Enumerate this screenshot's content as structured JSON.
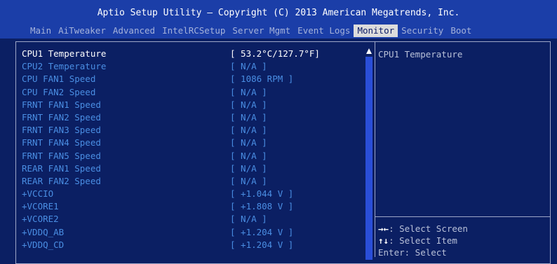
{
  "header": {
    "title": "Aptio Setup Utility – Copyright (C) 2013 American Megatrends, Inc.",
    "tabs": [
      {
        "label": "Main",
        "active": false
      },
      {
        "label": "AiTweaker",
        "active": false
      },
      {
        "label": "Advanced",
        "active": false
      },
      {
        "label": "IntelRCSetup",
        "active": false
      },
      {
        "label": "Server Mgmt",
        "active": false
      },
      {
        "label": "Event Logs",
        "active": false
      },
      {
        "label": "Monitor",
        "active": true
      },
      {
        "label": "Security",
        "active": false
      },
      {
        "label": "Boot",
        "active": false
      }
    ]
  },
  "monitor": {
    "items": [
      {
        "label": "CPU1 Temperature",
        "value": "[ 53.2°C/127.7°F]"
      },
      {
        "label": "CPU2 Temperature",
        "value": "[ N/A ]"
      },
      {
        "label": "CPU FAN1 Speed",
        "value": "[ 1086 RPM ]"
      },
      {
        "label": "CPU FAN2 Speed",
        "value": "[ N/A ]"
      },
      {
        "label": "FRNT FAN1 Speed",
        "value": "[ N/A ]"
      },
      {
        "label": "FRNT FAN2 Speed",
        "value": "[ N/A ]"
      },
      {
        "label": "FRNT FAN3 Speed",
        "value": "[ N/A ]"
      },
      {
        "label": "FRNT FAN4 Speed",
        "value": "[ N/A ]"
      },
      {
        "label": "FRNT FAN5 Speed",
        "value": "[ N/A ]"
      },
      {
        "label": "REAR FAN1 Speed",
        "value": "[ N/A ]"
      },
      {
        "label": "REAR FAN2 Speed",
        "value": "[ N/A ]"
      },
      {
        "label": "+VCCIO",
        "value": "[ +1.044 V ]"
      },
      {
        "label": "+VCORE1",
        "value": "[ +1.808 V ]"
      },
      {
        "label": "+VCORE2",
        "value": "[ N/A ]"
      },
      {
        "label": "+VDDQ_AB",
        "value": "[ +1.204 V ]"
      },
      {
        "label": "+VDDQ_CD",
        "value": "[ +1.204 V ]"
      }
    ],
    "selected_index": 0
  },
  "help_panel": {
    "description": "CPU1 Temperature",
    "keys": [
      {
        "glyph": "→←",
        "text": ": Select Screen"
      },
      {
        "glyph": "↑↓",
        "text": ": Select Item"
      },
      {
        "glyph": "",
        "text": "Enter: Select"
      }
    ]
  },
  "colors": {
    "background": "#0b1f63",
    "header": "#1b3ea8",
    "item_text": "#4a8ee3",
    "selected_text": "#ffffff",
    "scrollbar": "#2a4ed8"
  },
  "icons": {
    "scroll_up": "scroll-up-arrow-icon"
  }
}
